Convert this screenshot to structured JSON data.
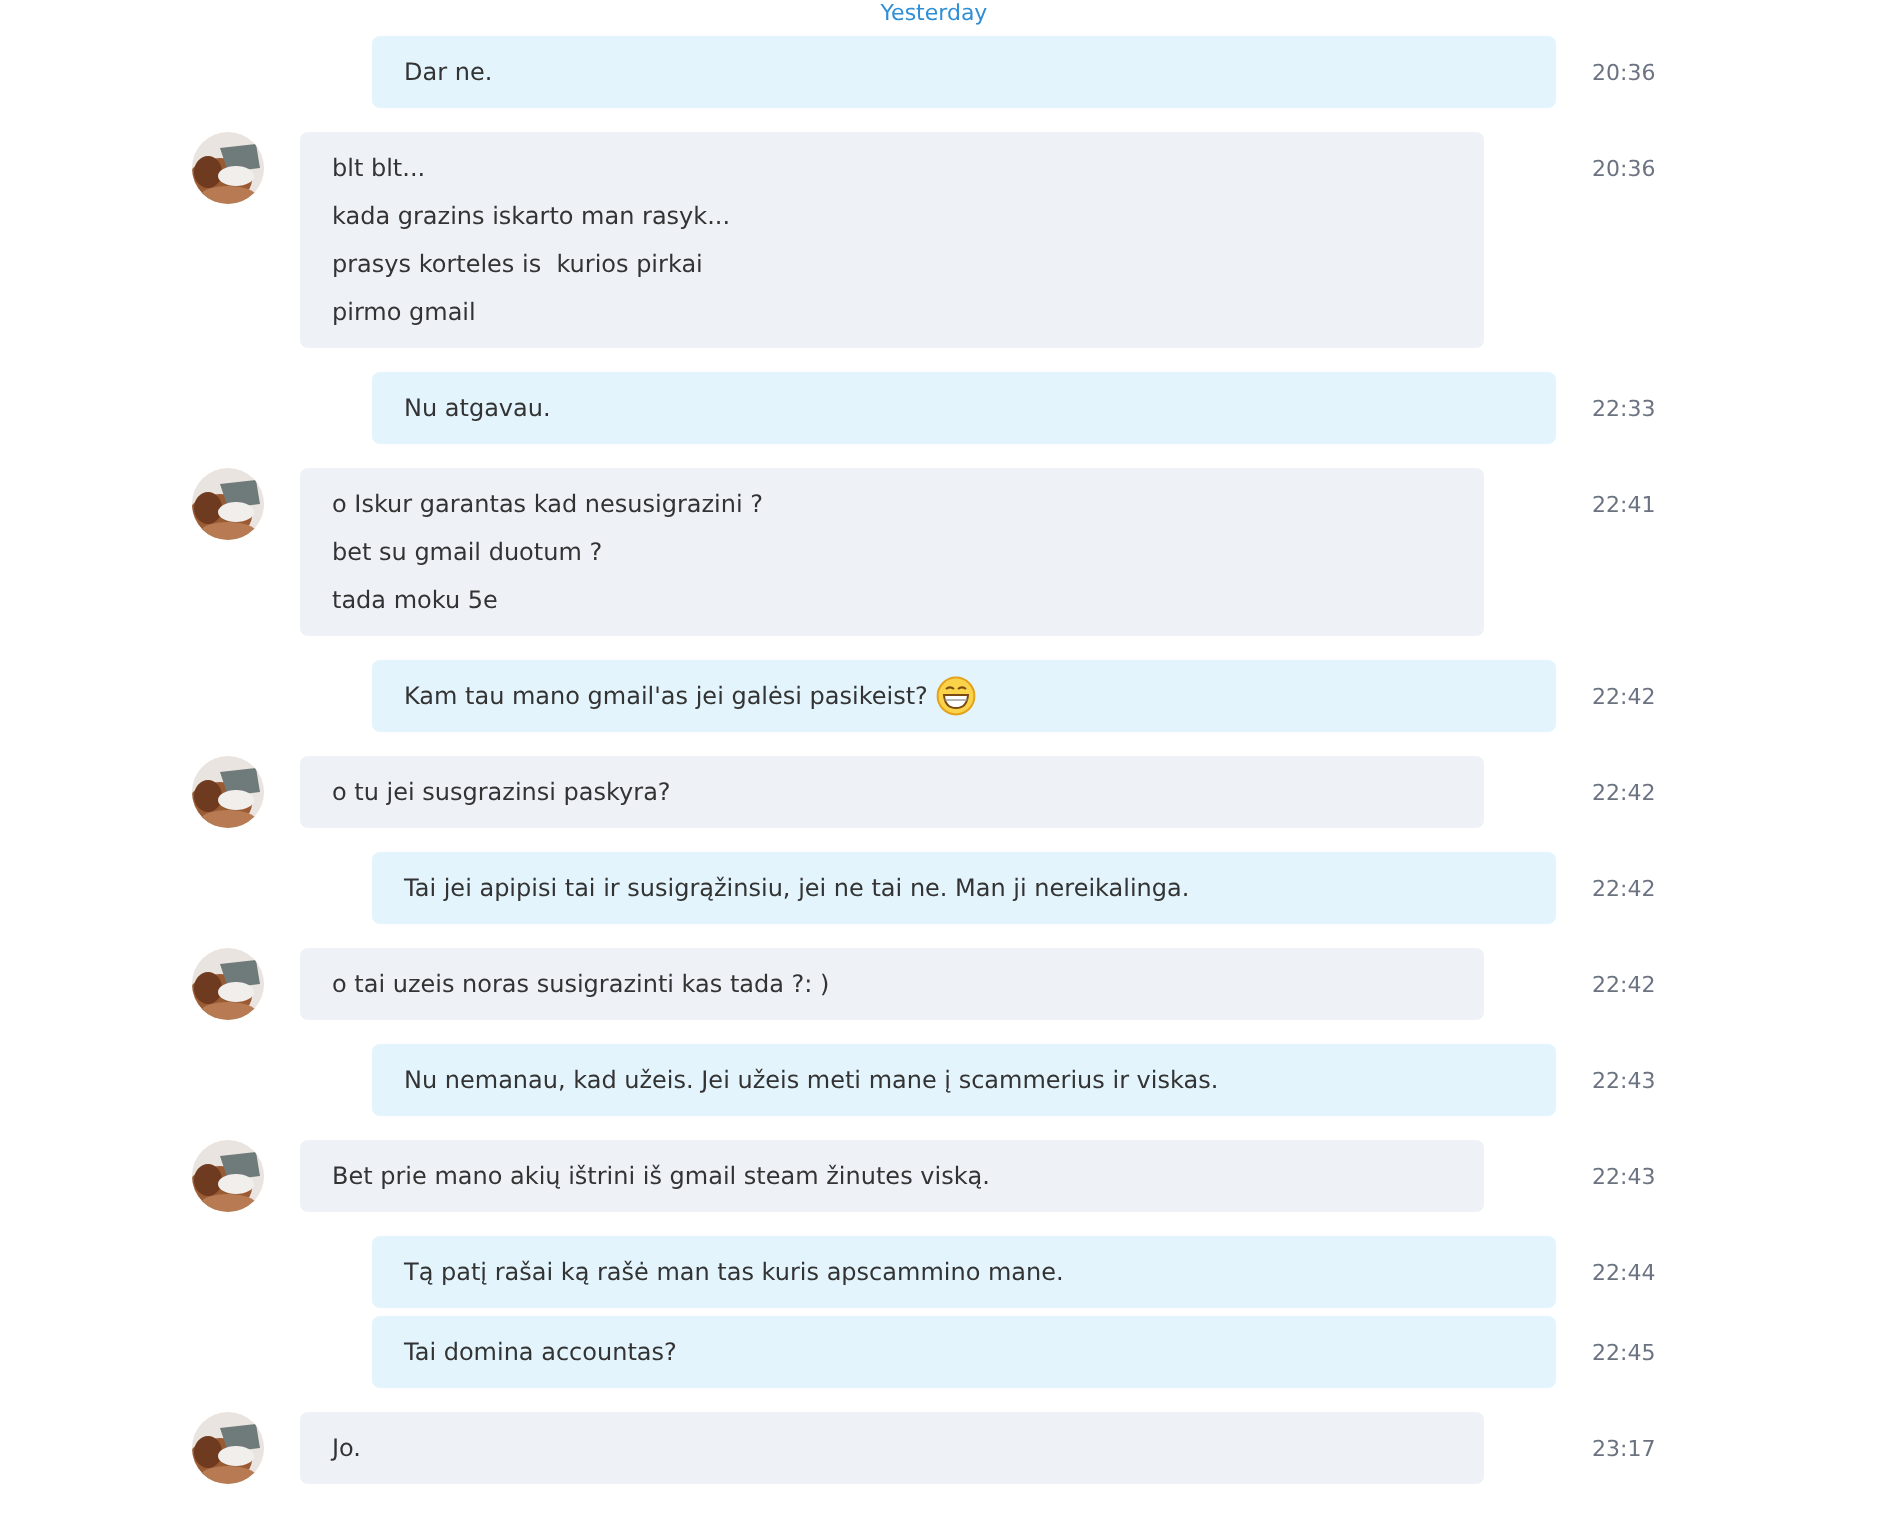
{
  "day_divider": "Yesterday",
  "messages": [
    {
      "kind": "outgoing",
      "lines": [
        "Dar ne."
      ],
      "time": "20:36"
    },
    {
      "kind": "incoming",
      "lines": [
        "blt blt...",
        "kada grazins iskarto man rasyk...",
        "prasys korteles is  kurios pirkai",
        "pirmo gmail"
      ],
      "time": "20:36"
    },
    {
      "kind": "outgoing",
      "lines": [
        "Nu atgavau."
      ],
      "time": "22:33"
    },
    {
      "kind": "incoming",
      "lines": [
        "o Iskur garantas kad nesusigrazini ?",
        "bet su gmail duotum ?",
        "tada moku 5e"
      ],
      "time": "22:41"
    },
    {
      "kind": "outgoing",
      "lines": [
        "Kam tau mano gmail'as jei galėsi pasikeist?"
      ],
      "emoticon": true,
      "time": "22:42"
    },
    {
      "kind": "incoming",
      "lines": [
        "o tu jei susgrazinsi paskyra?"
      ],
      "time": "22:42"
    },
    {
      "kind": "outgoing",
      "lines": [
        "Tai jei apipisi tai ir susigrąžinsiu, jei ne tai ne. Man ji nereikalinga."
      ],
      "time": "22:42"
    },
    {
      "kind": "incoming",
      "lines": [
        "o tai uzeis noras susigrazinti kas tada ?: )"
      ],
      "time": "22:42"
    },
    {
      "kind": "outgoing",
      "lines": [
        "Nu nemanau, kad užeis. Jei užeis meti mane į scammerius ir viskas."
      ],
      "time": "22:43"
    },
    {
      "kind": "incoming",
      "lines": [
        "Bet prie mano akių ištrini iš gmail steam žinutes viską."
      ],
      "time": "22:43"
    },
    {
      "kind": "outgoing",
      "lines": [
        "Tą patį rašai ką rašė man tas kuris apscammino mane."
      ],
      "time": "22:44"
    },
    {
      "kind": "outgoing",
      "lines": [
        "Tai domina accountas?"
      ],
      "time": "22:45"
    },
    {
      "kind": "incoming",
      "lines": [
        "Jo."
      ],
      "time": "23:17"
    }
  ]
}
